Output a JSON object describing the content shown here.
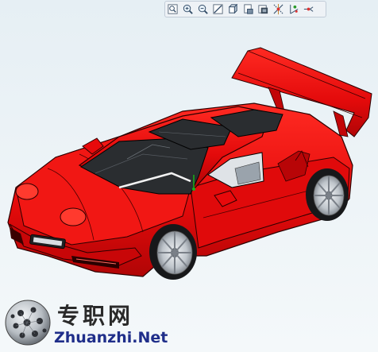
{
  "toolbar": {
    "buttons": [
      {
        "name": "zoom-fit-icon"
      },
      {
        "name": "zoom-in-icon"
      },
      {
        "name": "zoom-out-icon"
      },
      {
        "name": "sketch-view-icon"
      },
      {
        "name": "view-orientation-icon"
      },
      {
        "name": "display-style-icon"
      },
      {
        "name": "section-view-icon"
      },
      {
        "name": "datum-display-icon"
      },
      {
        "name": "spin-center-icon"
      }
    ]
  },
  "model": {
    "body_color": "#e8090b",
    "shadow_color": "#a80406",
    "glass_color": "#2a2d30",
    "wheel_color": "#c9ced3"
  },
  "watermark": {
    "chinese_text": "专职网",
    "site_text": "Zhuanzhi.Net"
  }
}
